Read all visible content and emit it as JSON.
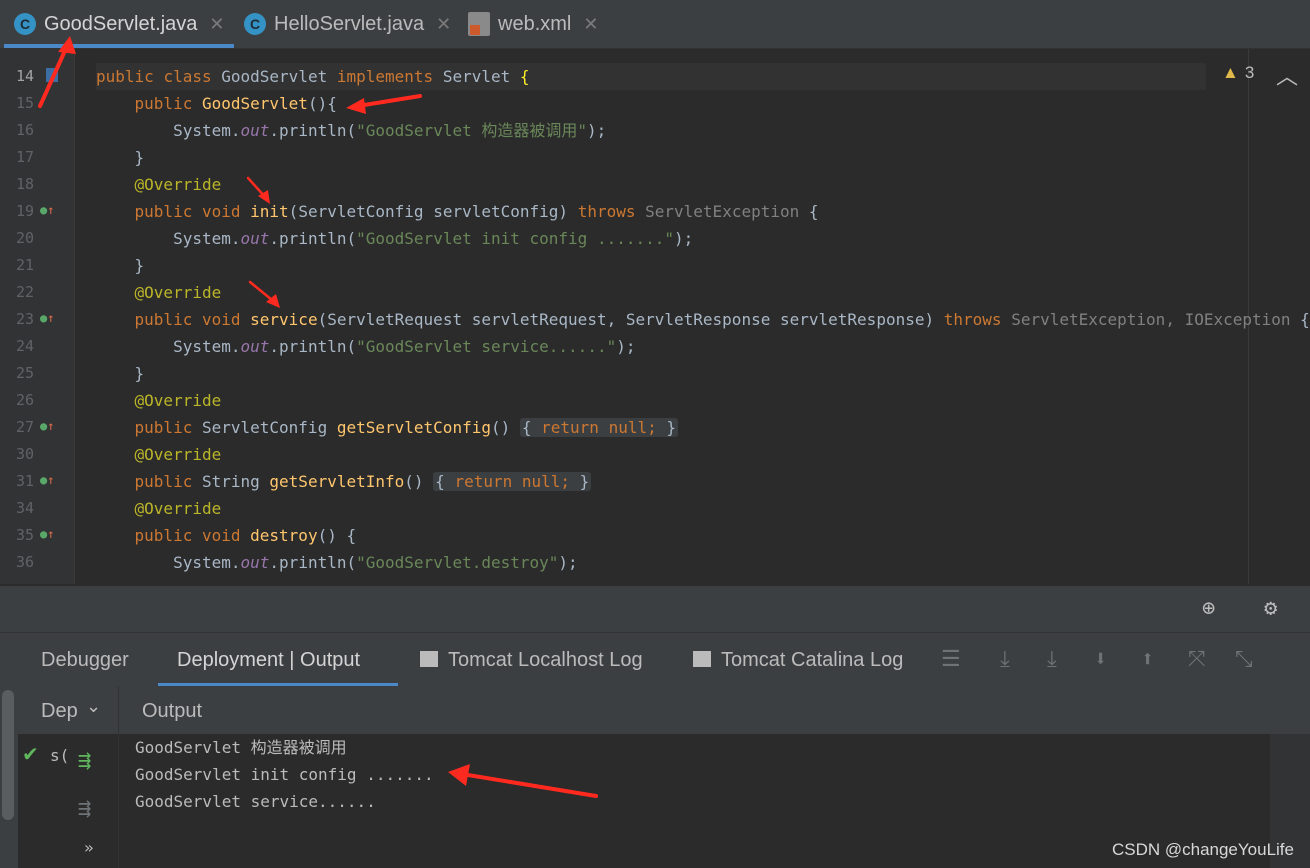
{
  "tabs": [
    {
      "label": "GoodServlet.java",
      "icon": "java-class-icon",
      "active": true
    },
    {
      "label": "HelloServlet.java",
      "icon": "java-class-icon",
      "active": false
    },
    {
      "label": "web.xml",
      "icon": "xml-file-icon",
      "active": false
    }
  ],
  "editor": {
    "warning_count": "3",
    "lines": {
      "l14": {
        "num": "14"
      },
      "l15": {
        "num": "15"
      },
      "l16": {
        "num": "16"
      },
      "l17": {
        "num": "17"
      },
      "l18": {
        "num": "18"
      },
      "l19": {
        "num": "19"
      },
      "l20": {
        "num": "20"
      },
      "l21": {
        "num": "21"
      },
      "l22": {
        "num": "22"
      },
      "l23": {
        "num": "23"
      },
      "l24": {
        "num": "24"
      },
      "l25": {
        "num": "25"
      },
      "l26": {
        "num": "26"
      },
      "l27": {
        "num": "27"
      },
      "l30": {
        "num": "30"
      },
      "l31": {
        "num": "31"
      },
      "l34": {
        "num": "34"
      },
      "l35": {
        "num": "35"
      },
      "l36": {
        "num": "36"
      }
    },
    "code": {
      "public": "public",
      "class": "class",
      "void": "void",
      "implements": "implements",
      "throws": "throws",
      "return": "return",
      "null": "null",
      "override": "@Override",
      "class_name": "GoodServlet",
      "servlet": "Servlet",
      "system": "System",
      "out": "out",
      "println": "println",
      "init": "init",
      "service": "service",
      "destroy": "destroy",
      "get_servlet_config": "getServletConfig",
      "get_servlet_info": "getServletInfo",
      "servlet_config_type": "ServletConfig",
      "servlet_config_param": "servletConfig",
      "servlet_request_type": "ServletRequest",
      "servlet_request_param": "servletRequest",
      "servlet_response_type": "ServletResponse",
      "servlet_response_param": "servletResponse",
      "servlet_exception": "ServletException",
      "io_exception": "IOException",
      "string_type": "String",
      "str_constructor": "\"GoodServlet 构造器被调用\"",
      "str_init": "\"GoodServlet init config .......\"",
      "str_service": "\"GoodServlet service......\"",
      "str_destroy": "\"GoodServlet.destroy\""
    }
  },
  "tool_window": {
    "tabs": [
      {
        "label": "Debugger"
      },
      {
        "label": "Deployment | Output",
        "active": true
      },
      {
        "label": "Tomcat Localhost Log"
      },
      {
        "label": "Tomcat Catalina Log"
      }
    ],
    "deployment_header": "Dep",
    "output_header": "Output",
    "deploy_item": "s(",
    "output_lines": [
      "GoodServlet 构造器被调用",
      "GoodServlet init config .......",
      "GoodServlet service......"
    ],
    "more": "»"
  },
  "watermark": "CSDN @changeYouLife",
  "colors": {
    "keyword": "#cc7832",
    "method": "#ffc66d",
    "string": "#6a8759",
    "annotation": "#bbb529",
    "accent": "#4a88c7",
    "annotation_arrow": "#ff2a1f"
  }
}
